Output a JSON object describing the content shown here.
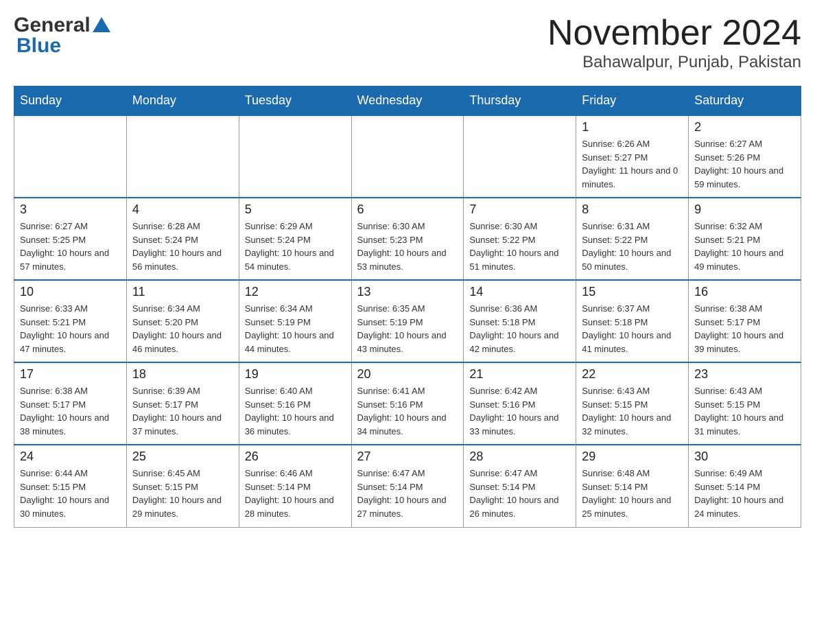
{
  "header": {
    "title": "November 2024",
    "subtitle": "Bahawalpur, Punjab, Pakistan"
  },
  "logo": {
    "general": "General",
    "blue": "Blue"
  },
  "days_of_week": [
    "Sunday",
    "Monday",
    "Tuesday",
    "Wednesday",
    "Thursday",
    "Friday",
    "Saturday"
  ],
  "weeks": [
    [
      {
        "day": "",
        "info": ""
      },
      {
        "day": "",
        "info": ""
      },
      {
        "day": "",
        "info": ""
      },
      {
        "day": "",
        "info": ""
      },
      {
        "day": "",
        "info": ""
      },
      {
        "day": "1",
        "info": "Sunrise: 6:26 AM\nSunset: 5:27 PM\nDaylight: 11 hours and 0 minutes."
      },
      {
        "day": "2",
        "info": "Sunrise: 6:27 AM\nSunset: 5:26 PM\nDaylight: 10 hours and 59 minutes."
      }
    ],
    [
      {
        "day": "3",
        "info": "Sunrise: 6:27 AM\nSunset: 5:25 PM\nDaylight: 10 hours and 57 minutes."
      },
      {
        "day": "4",
        "info": "Sunrise: 6:28 AM\nSunset: 5:24 PM\nDaylight: 10 hours and 56 minutes."
      },
      {
        "day": "5",
        "info": "Sunrise: 6:29 AM\nSunset: 5:24 PM\nDaylight: 10 hours and 54 minutes."
      },
      {
        "day": "6",
        "info": "Sunrise: 6:30 AM\nSunset: 5:23 PM\nDaylight: 10 hours and 53 minutes."
      },
      {
        "day": "7",
        "info": "Sunrise: 6:30 AM\nSunset: 5:22 PM\nDaylight: 10 hours and 51 minutes."
      },
      {
        "day": "8",
        "info": "Sunrise: 6:31 AM\nSunset: 5:22 PM\nDaylight: 10 hours and 50 minutes."
      },
      {
        "day": "9",
        "info": "Sunrise: 6:32 AM\nSunset: 5:21 PM\nDaylight: 10 hours and 49 minutes."
      }
    ],
    [
      {
        "day": "10",
        "info": "Sunrise: 6:33 AM\nSunset: 5:21 PM\nDaylight: 10 hours and 47 minutes."
      },
      {
        "day": "11",
        "info": "Sunrise: 6:34 AM\nSunset: 5:20 PM\nDaylight: 10 hours and 46 minutes."
      },
      {
        "day": "12",
        "info": "Sunrise: 6:34 AM\nSunset: 5:19 PM\nDaylight: 10 hours and 44 minutes."
      },
      {
        "day": "13",
        "info": "Sunrise: 6:35 AM\nSunset: 5:19 PM\nDaylight: 10 hours and 43 minutes."
      },
      {
        "day": "14",
        "info": "Sunrise: 6:36 AM\nSunset: 5:18 PM\nDaylight: 10 hours and 42 minutes."
      },
      {
        "day": "15",
        "info": "Sunrise: 6:37 AM\nSunset: 5:18 PM\nDaylight: 10 hours and 41 minutes."
      },
      {
        "day": "16",
        "info": "Sunrise: 6:38 AM\nSunset: 5:17 PM\nDaylight: 10 hours and 39 minutes."
      }
    ],
    [
      {
        "day": "17",
        "info": "Sunrise: 6:38 AM\nSunset: 5:17 PM\nDaylight: 10 hours and 38 minutes."
      },
      {
        "day": "18",
        "info": "Sunrise: 6:39 AM\nSunset: 5:17 PM\nDaylight: 10 hours and 37 minutes."
      },
      {
        "day": "19",
        "info": "Sunrise: 6:40 AM\nSunset: 5:16 PM\nDaylight: 10 hours and 36 minutes."
      },
      {
        "day": "20",
        "info": "Sunrise: 6:41 AM\nSunset: 5:16 PM\nDaylight: 10 hours and 34 minutes."
      },
      {
        "day": "21",
        "info": "Sunrise: 6:42 AM\nSunset: 5:16 PM\nDaylight: 10 hours and 33 minutes."
      },
      {
        "day": "22",
        "info": "Sunrise: 6:43 AM\nSunset: 5:15 PM\nDaylight: 10 hours and 32 minutes."
      },
      {
        "day": "23",
        "info": "Sunrise: 6:43 AM\nSunset: 5:15 PM\nDaylight: 10 hours and 31 minutes."
      }
    ],
    [
      {
        "day": "24",
        "info": "Sunrise: 6:44 AM\nSunset: 5:15 PM\nDaylight: 10 hours and 30 minutes."
      },
      {
        "day": "25",
        "info": "Sunrise: 6:45 AM\nSunset: 5:15 PM\nDaylight: 10 hours and 29 minutes."
      },
      {
        "day": "26",
        "info": "Sunrise: 6:46 AM\nSunset: 5:14 PM\nDaylight: 10 hours and 28 minutes."
      },
      {
        "day": "27",
        "info": "Sunrise: 6:47 AM\nSunset: 5:14 PM\nDaylight: 10 hours and 27 minutes."
      },
      {
        "day": "28",
        "info": "Sunrise: 6:47 AM\nSunset: 5:14 PM\nDaylight: 10 hours and 26 minutes."
      },
      {
        "day": "29",
        "info": "Sunrise: 6:48 AM\nSunset: 5:14 PM\nDaylight: 10 hours and 25 minutes."
      },
      {
        "day": "30",
        "info": "Sunrise: 6:49 AM\nSunset: 5:14 PM\nDaylight: 10 hours and 24 minutes."
      }
    ]
  ]
}
